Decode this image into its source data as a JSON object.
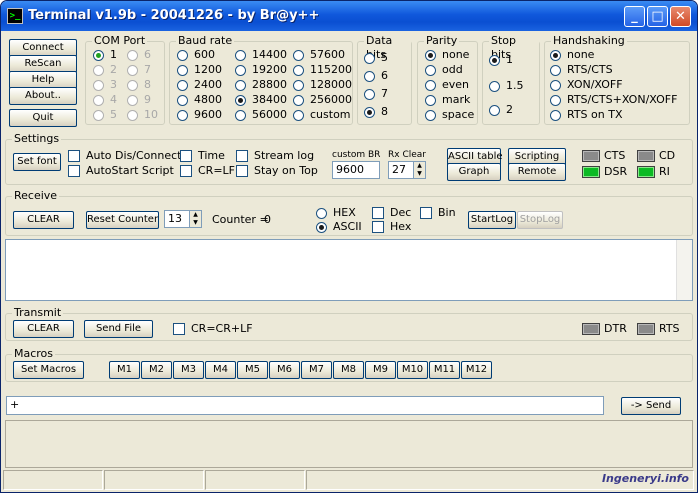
{
  "window": {
    "title": "Terminal v1.9b - 20041226 - by Br@y++",
    "app_icon": "terminal-icon",
    "controls": [
      "minimize-icon",
      "maximize-icon",
      "close-icon"
    ]
  },
  "left_buttons": {
    "connect": "Connect",
    "rescan": "ReScan",
    "help": "Help",
    "about": "About..",
    "quit": "Quit"
  },
  "com_port": {
    "label": "COM Port",
    "options": [
      "1",
      "2",
      "3",
      "4",
      "5",
      "6",
      "7",
      "8",
      "9",
      "10"
    ],
    "selected": "1"
  },
  "baud_rate": {
    "label": "Baud rate",
    "options": [
      "600",
      "1200",
      "2400",
      "4800",
      "9600",
      "14400",
      "19200",
      "28800",
      "38400",
      "56000",
      "57600",
      "115200",
      "128000",
      "256000",
      "custom"
    ],
    "selected": "38400"
  },
  "data_bits": {
    "label": "Data bits",
    "options": [
      "5",
      "6",
      "7",
      "8"
    ],
    "selected": "8"
  },
  "parity": {
    "label": "Parity",
    "options": [
      "none",
      "odd",
      "even",
      "mark",
      "space"
    ],
    "selected": "none"
  },
  "stop_bits": {
    "label": "Stop bits",
    "options": [
      "1",
      "1.5",
      "2"
    ],
    "selected": "1"
  },
  "handshaking": {
    "label": "Handshaking",
    "options": [
      "none",
      "RTS/CTS",
      "XON/XOFF",
      "RTS/CTS+XON/XOFF",
      "RTS on TX"
    ],
    "selected": "none"
  },
  "settings": {
    "label": "Settings",
    "set_font": "Set font",
    "auto_dis_connect": "Auto Dis/Connect",
    "autostart_script": "AutoStart Script",
    "time": "Time",
    "cr_lf": "CR=LF",
    "stream_log": "Stream log",
    "stay_on_top": "Stay on Top",
    "custom_br_label": "custom BR",
    "custom_br_value": "9600",
    "rx_clear_label": "Rx Clear",
    "rx_clear_value": "27",
    "ascii_table": "ASCII table",
    "graph": "Graph",
    "scripting": "Scripting",
    "remote": "Remote",
    "leds": {
      "cts": "CTS",
      "cd": "CD",
      "dsr": "DSR",
      "ri": "RI"
    }
  },
  "receive": {
    "label": "Receive",
    "clear": "CLEAR",
    "reset_counter": "Reset Counter",
    "counter_spin_value": "13",
    "counter_label": "Counter = ",
    "counter_value": "0",
    "hex": "HEX",
    "ascii": "ASCII",
    "mode_selected": "ASCII",
    "dec": "Dec",
    "bin": "Bin",
    "hex_chk": "Hex",
    "start_log": "StartLog",
    "stop_log": "StopLog"
  },
  "transmit": {
    "label": "Transmit",
    "clear": "CLEAR",
    "send_file": "Send File",
    "cr_cr_lf": "CR=CR+LF",
    "dtr": "DTR",
    "rts": "RTS"
  },
  "macros": {
    "label": "Macros",
    "set_macros": "Set Macros",
    "buttons": [
      "M1",
      "M2",
      "M3",
      "M4",
      "M5",
      "M6",
      "M7",
      "M8",
      "M9",
      "M10",
      "M11",
      "M12"
    ]
  },
  "send": {
    "input_value": "+",
    "send_button": "-> Send"
  },
  "watermark": "Ingeneryi.info"
}
